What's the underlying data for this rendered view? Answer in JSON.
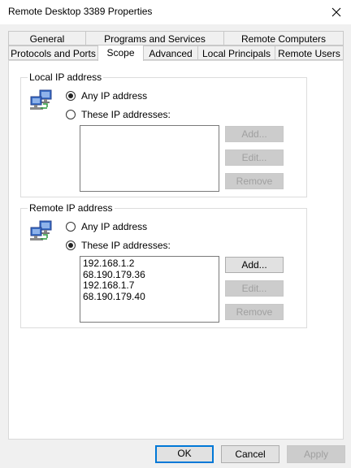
{
  "window": {
    "title": "Remote  Desktop 3389 Properties"
  },
  "tabs": {
    "row_back": [
      "General",
      "Programs and Services",
      "Remote Computers"
    ],
    "row_front": [
      "Protocols and Ports",
      "Scope",
      "Advanced",
      "Local Principals",
      "Remote Users"
    ],
    "active": "Scope"
  },
  "local": {
    "legend": "Local IP address",
    "any_label": "Any IP address",
    "these_label": "These IP addresses:",
    "selected": "any",
    "addresses": [],
    "add_label": "Add...",
    "edit_label": "Edit...",
    "remove_label": "Remove"
  },
  "remote": {
    "legend": "Remote IP address",
    "any_label": "Any IP address",
    "these_label": "These IP addresses:",
    "selected": "these",
    "addresses": [
      "192.168.1.2",
      "68.190.179.36",
      "192.168.1.7",
      "68.190.179.40"
    ],
    "add_label": "Add...",
    "edit_label": "Edit...",
    "remove_label": "Remove"
  },
  "dialog_buttons": {
    "ok": "OK",
    "cancel": "Cancel",
    "apply": "Apply"
  },
  "icons": {
    "close": "close-icon",
    "network": "network-computers-icon"
  },
  "colors": {
    "accent": "#0078d7",
    "window_bg": "#f0f0f0",
    "disabled_text": "#a0a0a0"
  }
}
